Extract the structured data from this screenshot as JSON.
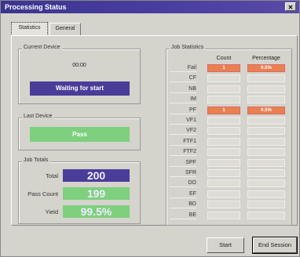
{
  "window": {
    "title": "Processing Status"
  },
  "tabs": [
    {
      "label": "Statistics"
    },
    {
      "label": "General"
    }
  ],
  "current_device": {
    "label": "Current Device",
    "address": "00:00",
    "status": "Waiting for start",
    "status_color": "#4a3d9a"
  },
  "last_device": {
    "label": "Last Device",
    "status": "Pass",
    "status_color": "#7ed07e"
  },
  "job_totals": {
    "label": "Job Totals",
    "rows": [
      {
        "name": "Total",
        "value": "200",
        "color": "#4a3d9a"
      },
      {
        "name": "Pass Count",
        "value": "199",
        "color": "#7ed07e"
      },
      {
        "name": "Yield",
        "value": "99.5%",
        "color": "#7ed07e"
      }
    ]
  },
  "job_statistics": {
    "label": "Job Statistics",
    "headers": {
      "count": "Count",
      "percentage": "Percentage"
    },
    "rows": [
      {
        "name": "Fail",
        "count": "1",
        "percentage": "0.5%",
        "highlight": true
      },
      {
        "name": "CF",
        "count": "",
        "percentage": ""
      },
      {
        "name": "NB",
        "count": "",
        "percentage": ""
      },
      {
        "name": "IM",
        "count": "",
        "percentage": ""
      },
      {
        "name": "PF",
        "count": "1",
        "percentage": "0.5%",
        "highlight": true
      },
      {
        "name": "VF1",
        "count": "",
        "percentage": ""
      },
      {
        "name": "VF2",
        "count": "",
        "percentage": ""
      },
      {
        "name": "FTF1",
        "count": "",
        "percentage": ""
      },
      {
        "name": "FTF2",
        "count": "",
        "percentage": ""
      },
      {
        "name": "SPF",
        "count": "",
        "percentage": ""
      },
      {
        "name": "SFR",
        "count": "",
        "percentage": ""
      },
      {
        "name": "DO",
        "count": "",
        "percentage": ""
      },
      {
        "name": "EF",
        "count": "",
        "percentage": ""
      },
      {
        "name": "BD",
        "count": "",
        "percentage": ""
      },
      {
        "name": "BE",
        "count": "",
        "percentage": ""
      }
    ],
    "highlight_color": "#e8814f"
  },
  "buttons": {
    "start": "Start",
    "end_session": "End Session"
  }
}
